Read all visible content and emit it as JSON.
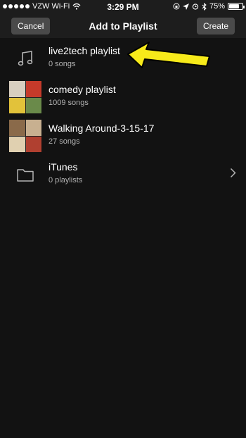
{
  "status_bar": {
    "carrier": "VZW Wi-Fi",
    "time": "3:29 PM",
    "battery_percent": "75%",
    "battery_level": 0.75,
    "icons": [
      "wifi-icon",
      "orientation-lock-icon",
      "location-icon",
      "alarm-icon",
      "bluetooth-icon",
      "battery-icon"
    ]
  },
  "nav": {
    "title": "Add to Playlist",
    "cancel_label": "Cancel",
    "create_label": "Create"
  },
  "items": [
    {
      "title": "live2tech playlist",
      "subtitle": "0 songs",
      "icon": "music-note-icon"
    },
    {
      "title": "comedy playlist",
      "subtitle": "1009 songs",
      "icon": "album-collage",
      "colors": [
        "#d8cfc0",
        "#c53a2a",
        "#e2c23a",
        "#6a8a4a"
      ]
    },
    {
      "title": "Walking Around-3-15-17",
      "subtitle": "27 songs",
      "icon": "album-collage",
      "colors": [
        "#8a6a4a",
        "#c8b090",
        "#e0d0b0",
        "#b04030"
      ]
    },
    {
      "title": "iTunes",
      "subtitle": "0 playlists",
      "icon": "folder-icon"
    }
  ],
  "annotation_color": "#f7ea1a"
}
